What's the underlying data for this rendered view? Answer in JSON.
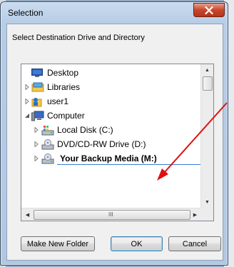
{
  "window": {
    "title": "Selection"
  },
  "prompt": "Select Destination Drive and Directory",
  "tree": {
    "items": [
      {
        "label": "Desktop",
        "icon": "desktop-icon",
        "expander": "none",
        "indent": 0
      },
      {
        "label": "Libraries",
        "icon": "libraries-icon",
        "expander": "collapsed",
        "indent": 0
      },
      {
        "label": "user1",
        "icon": "user-folder-icon",
        "expander": "collapsed",
        "indent": 0
      },
      {
        "label": "Computer",
        "icon": "computer-icon",
        "expander": "expanded",
        "indent": 0
      },
      {
        "label": "Local Disk (C:)",
        "icon": "local-disk-icon",
        "expander": "collapsed",
        "indent": 1
      },
      {
        "label": "DVD/CD-RW Drive (D:)",
        "icon": "dvd-drive-icon",
        "expander": "collapsed",
        "indent": 1
      },
      {
        "label": "Your Backup Media (M:)",
        "icon": "removable-drive-icon",
        "expander": "collapsed",
        "indent": 1,
        "selected": true
      }
    ],
    "hscroll_grip": "III"
  },
  "buttons": {
    "make_new_folder": "Make New Folder",
    "ok": "OK",
    "cancel": "Cancel"
  },
  "annotation": {
    "arrow_color": "#e01010"
  }
}
